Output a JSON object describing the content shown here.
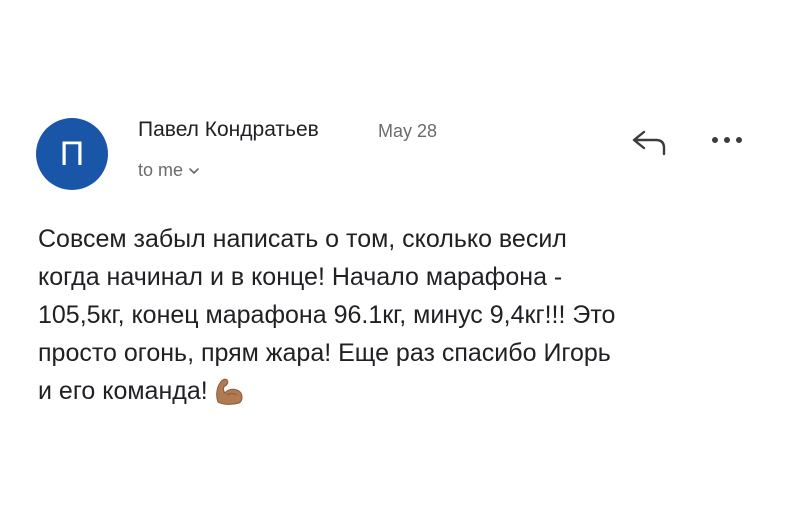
{
  "sender": {
    "avatar_letter": "П",
    "name": "Павел Кондратьев",
    "date": "May 28",
    "recipient": "to me"
  },
  "actions": {
    "reply_icon": "reply-icon",
    "more_icon": "more-horizontal-icon"
  },
  "message": {
    "lines": [
      "Совсем забыл написать о том, сколько весил",
      "когда начинал и в конце! Начало марафона -",
      "105,5кг, конец марафона 96.1кг, минус 9,4кг!!! Это",
      "просто огонь, прям жара! Еще раз спасибо Игорь",
      "и его команда!"
    ],
    "emoji": "flexed-biceps-emoji"
  },
  "colors": {
    "avatar_bg": "#1a56a7",
    "text": "#202124",
    "muted": "#6b6b6b"
  }
}
